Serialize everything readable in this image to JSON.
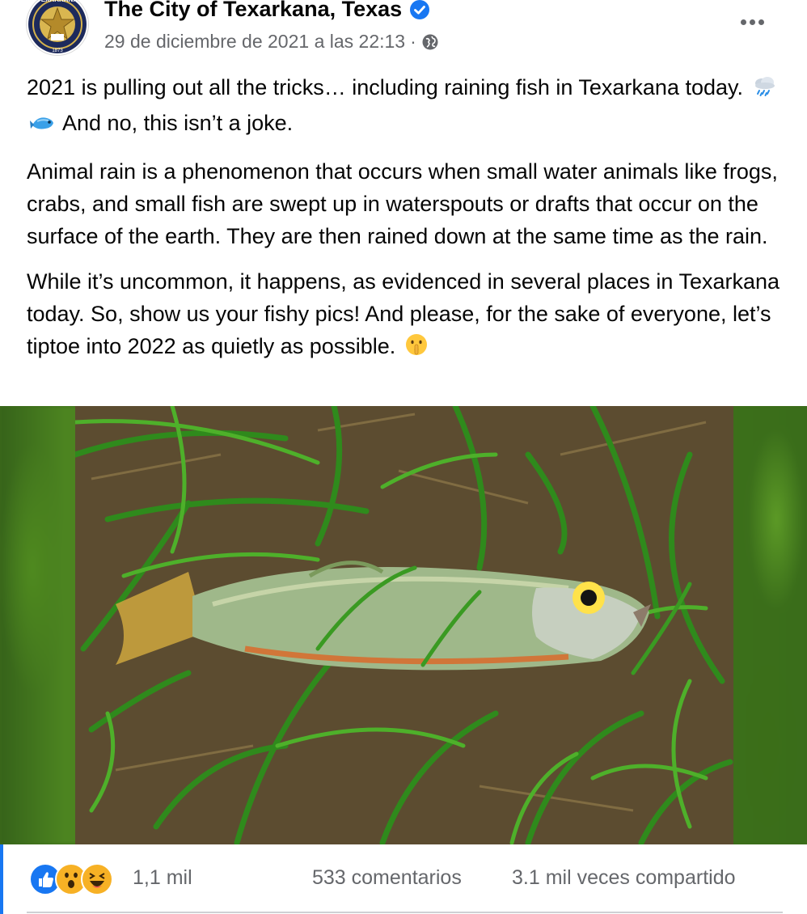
{
  "post": {
    "page_name": "The City of Texarkana, Texas",
    "timestamp": "29 de diciembre de 2021 a las 22:13",
    "separator": "·",
    "privacy_icon": "globe-icon",
    "verified_icon": "verified-badge-icon",
    "more_icon": "more-options-icon",
    "avatar_icon": "city-seal-logo",
    "avatar_text": "CITY OF TEXARKANA 1873",
    "paragraphs": {
      "p1_a": "2021 is pulling out all the tricks… including raining fish in Texarkana today.",
      "p1_b": "And no, this isn’t a joke.",
      "p2": "Animal rain is a phenomenon that occurs when small water animals like frogs, crabs, and small fish are swept up in waterspouts or drafts that occur on the surface of the earth. They are then rained down at the same time as the rain.",
      "p3": "While it’s uncommon, it happens, as evidenced in several places in Texarkana today. So, show us your fishy pics! And please, for the sake of everyone, let’s tiptoe into 2022 as quietly as possible."
    },
    "emojis": [
      "cloud-with-rain-icon",
      "fish-icon",
      "shushing-face-icon"
    ],
    "photo": "photo of a small fish lying on grass"
  },
  "engagement": {
    "reaction_icons": [
      "like-icon",
      "wow-icon",
      "haha-icon"
    ],
    "reaction_count": "1,1 mil",
    "comments": "533 comentarios",
    "shares": "3.1 mil veces compartido"
  },
  "colors": {
    "accent": "#1877f2",
    "secondary_text": "#65676b",
    "primary_text": "#050505",
    "divider": "#ced0d4"
  }
}
